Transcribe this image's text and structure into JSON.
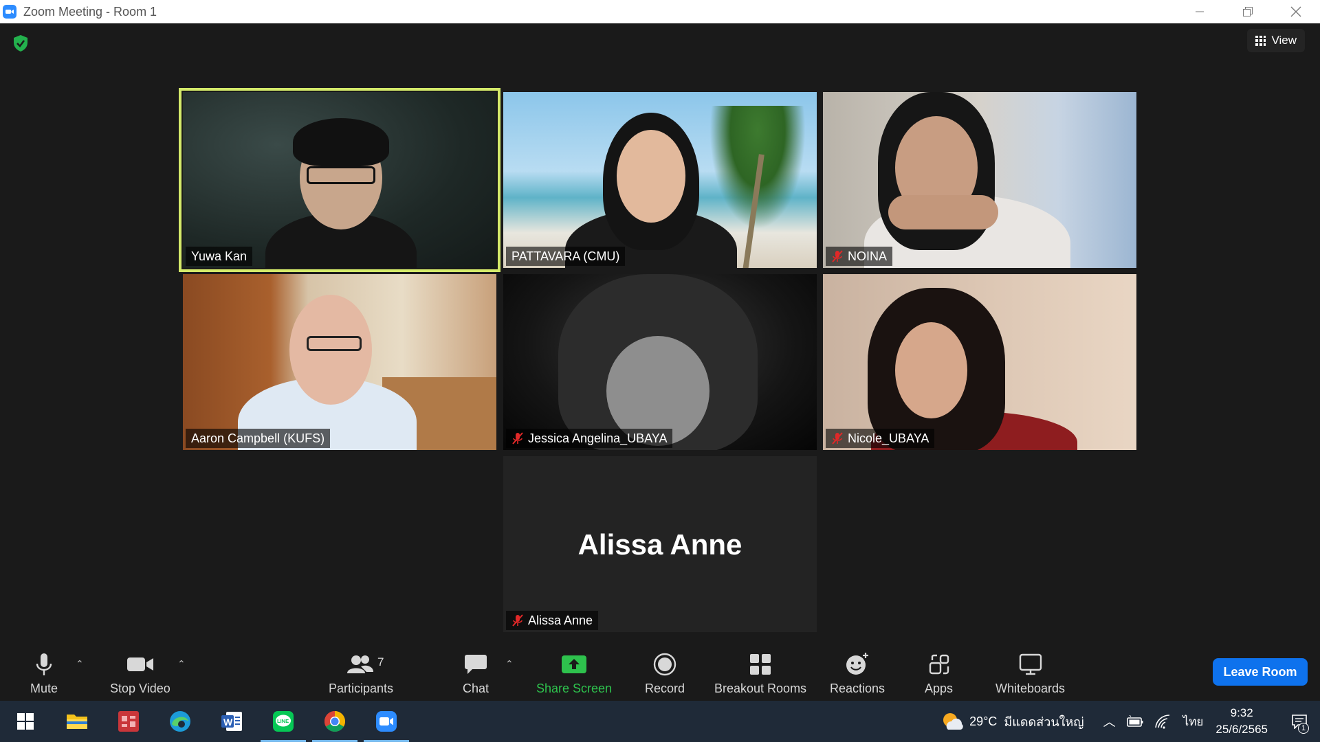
{
  "window": {
    "title": "Zoom Meeting - Room 1"
  },
  "top": {
    "view_label": "View"
  },
  "participants": [
    {
      "name": "Yuwa Kan",
      "muted": false,
      "active_speaker": true
    },
    {
      "name": "PATTAVARA (CMU)",
      "muted": false,
      "active_speaker": false
    },
    {
      "name": "NOINA",
      "muted": true,
      "active_speaker": false
    },
    {
      "name": "Aaron Campbell (KUFS)",
      "muted": false,
      "active_speaker": false
    },
    {
      "name": "Jessica Angelina_UBAYA",
      "muted": true,
      "active_speaker": false
    },
    {
      "name": "Nicole_UBAYA",
      "muted": true,
      "active_speaker": false
    },
    {
      "name": "Alissa Anne",
      "muted": true,
      "active_speaker": false,
      "video_off": true
    }
  ],
  "toolbar": {
    "mute_label": "Mute",
    "stop_video_label": "Stop Video",
    "participants_label": "Participants",
    "participants_count": "7",
    "chat_label": "Chat",
    "share_screen_label": "Share Screen",
    "record_label": "Record",
    "breakout_rooms_label": "Breakout Rooms",
    "reactions_label": "Reactions",
    "apps_label": "Apps",
    "whiteboards_label": "Whiteboards",
    "leave_label": "Leave Room"
  },
  "taskbar": {
    "weather_temp": "29°C",
    "weather_location": "มีแดดส่วนใหญ่",
    "language": "ไทย",
    "time": "9:32",
    "date": "25/6/2565",
    "notification_count": "1"
  },
  "colors": {
    "active_speaker_border": "#d4ea6a",
    "leave_button": "#0e72ed",
    "share_screen": "#2ec24d",
    "muted_icon": "#e02828"
  }
}
